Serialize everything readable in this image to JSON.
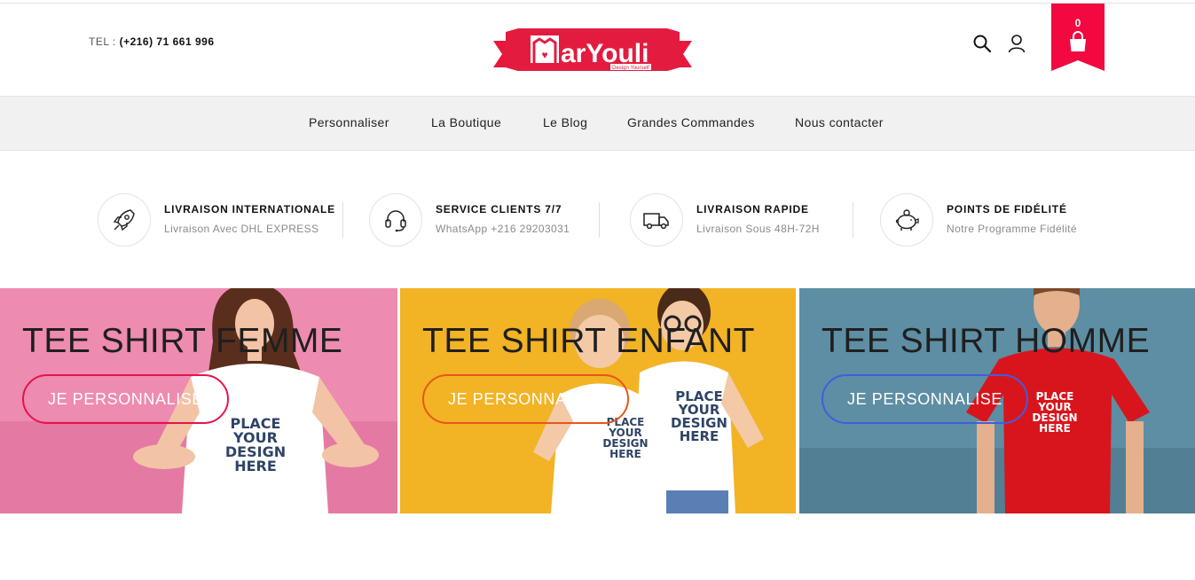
{
  "header": {
    "tel_label": "TEL :",
    "tel_number": "(+216) 71 661 996",
    "logo_text": "arYouli",
    "logo_tagline": "Design Yourself",
    "cart_count": "0",
    "icons": [
      "search-icon",
      "user-icon",
      "shopping-bag-icon"
    ],
    "accent_color": "#f1093f"
  },
  "nav": {
    "items": [
      {
        "label": "Personnaliser"
      },
      {
        "label": "La Boutique"
      },
      {
        "label": "Le Blog"
      },
      {
        "label": "Grandes Commandes"
      },
      {
        "label": "Nous contacter"
      }
    ]
  },
  "features": [
    {
      "icon": "rocket-icon",
      "title": "LIVRAISON INTERNATIONALE",
      "subtitle": "Livraison Avec DHL EXPRESS"
    },
    {
      "icon": "headset-icon",
      "title": "SERVICE CLIENTS 7/7",
      "subtitle": "WhatsApp +216 29203031"
    },
    {
      "icon": "truck-icon",
      "title": "LIVRAISON RAPIDE",
      "subtitle": "Livraison Sous 48H-72H"
    },
    {
      "icon": "piggy-bank-icon",
      "title": "POINTS DE FIDÉLITÉ",
      "subtitle": "Notre Programme Fidélité"
    }
  ],
  "banners": [
    {
      "title": "TEE SHIRT FEMME",
      "button": "JE PERSONNALISE",
      "shirt_text": "PLACE YOUR DESIGN HERE",
      "bg_color": "#ee8bb0",
      "button_border": "#e8134a"
    },
    {
      "title": "TEE SHIRT ENFANT",
      "button": "JE PERSONNALISE",
      "shirt_text": "PLACE YOUR DESIGN HERE",
      "bg_color": "#f2b324",
      "button_border": "#e8561a"
    },
    {
      "title": "TEE SHIRT HOMME",
      "button": "JE PERSONNALISE",
      "shirt_text": "PLACE YOUR DESIGN HERE",
      "bg_color": "#5d8ea3",
      "button_border": "#3d5fe0"
    }
  ]
}
